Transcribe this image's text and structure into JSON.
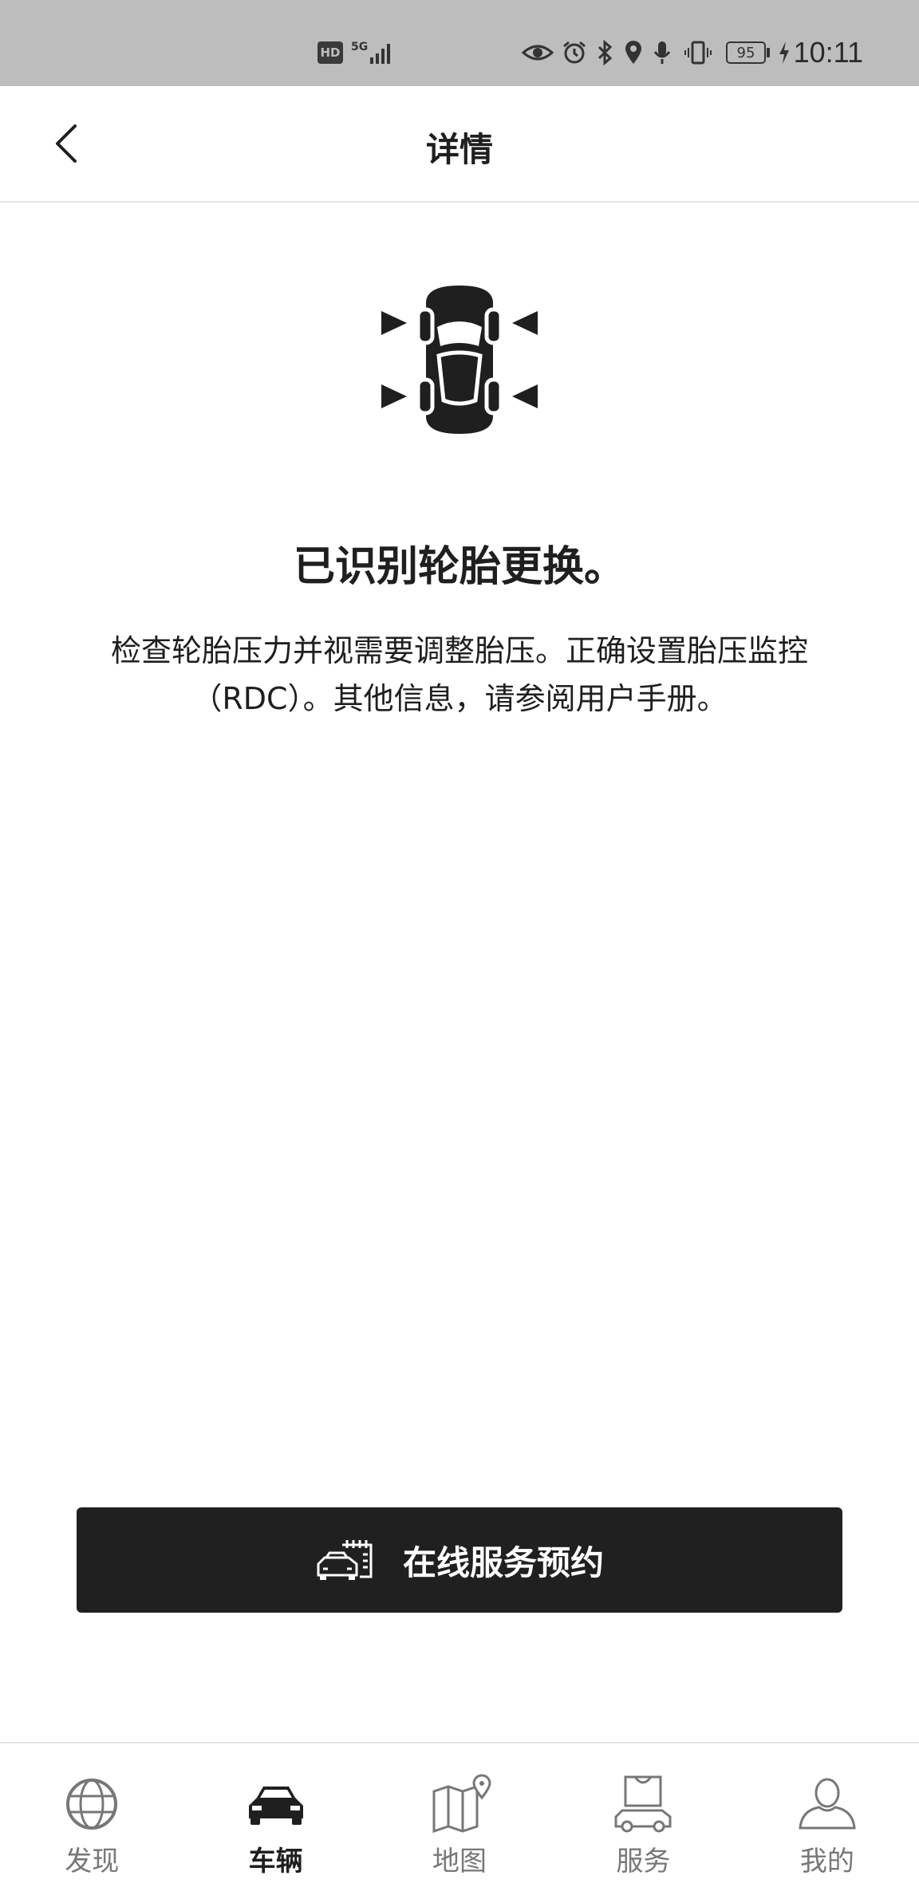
{
  "status_bar": {
    "hd_label": "HD",
    "network_label": "5G",
    "battery_level": "95",
    "time": "10:11"
  },
  "header": {
    "title": "详情",
    "back_icon": "chevron-left-icon"
  },
  "main": {
    "illustration_icon": "tire-change-car-icon",
    "title": "已识别轮胎更换。",
    "description": "检查轮胎压力并视需要调整胎压。正确设置胎压监控（RDC）。其他信息，请参阅用户手册。"
  },
  "cta": {
    "label": "在线服务预约",
    "icon": "car-service-calendar-icon"
  },
  "bottom_nav": {
    "active_index": 1,
    "items": [
      {
        "label": "发现",
        "icon": "globe-icon"
      },
      {
        "label": "车辆",
        "icon": "car-icon"
      },
      {
        "label": "地图",
        "icon": "map-icon"
      },
      {
        "label": "服务",
        "icon": "service-bag-icon"
      },
      {
        "label": "我的",
        "icon": "user-icon"
      }
    ]
  },
  "colors": {
    "status_bar_bg": "#bdbdbd",
    "cta_bg": "#202020",
    "text_primary": "#1f1f1f",
    "nav_inactive": "#777777"
  }
}
